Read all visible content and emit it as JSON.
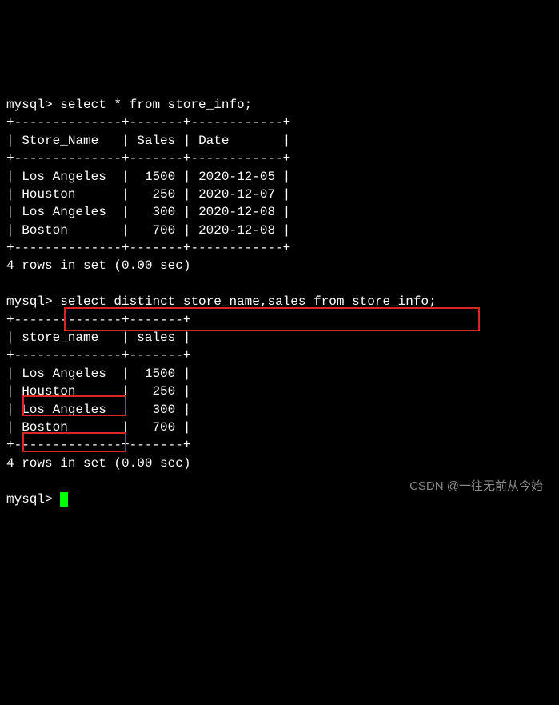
{
  "prompt": "mysql>",
  "query1": {
    "sql": "select * from store_info;",
    "headers": [
      "Store_Name",
      "Sales",
      "Date"
    ],
    "rows": [
      {
        "store": "Los Angeles",
        "sales": "1500",
        "date": "2020-12-05"
      },
      {
        "store": "Houston",
        "sales": "250",
        "date": "2020-12-07"
      },
      {
        "store": "Los Angeles",
        "sales": "300",
        "date": "2020-12-08"
      },
      {
        "store": "Boston",
        "sales": "700",
        "date": "2020-12-08"
      }
    ],
    "border_line": "+--------------+-------+------------+",
    "result_msg": "4 rows in set (0.00 sec)"
  },
  "query2": {
    "sql": "select distinct store_name,sales from store_info;",
    "headers": [
      "store_name",
      "sales"
    ],
    "rows": [
      {
        "store": "Los Angeles",
        "sales": "1500"
      },
      {
        "store": "Houston",
        "sales": "250"
      },
      {
        "store": "Los Angeles",
        "sales": "300"
      },
      {
        "store": "Boston",
        "sales": "700"
      }
    ],
    "border_line": "+--------------+-------+",
    "result_msg": "4 rows in set (0.00 sec)"
  },
  "watermark": "CSDN @一往无前从今始"
}
